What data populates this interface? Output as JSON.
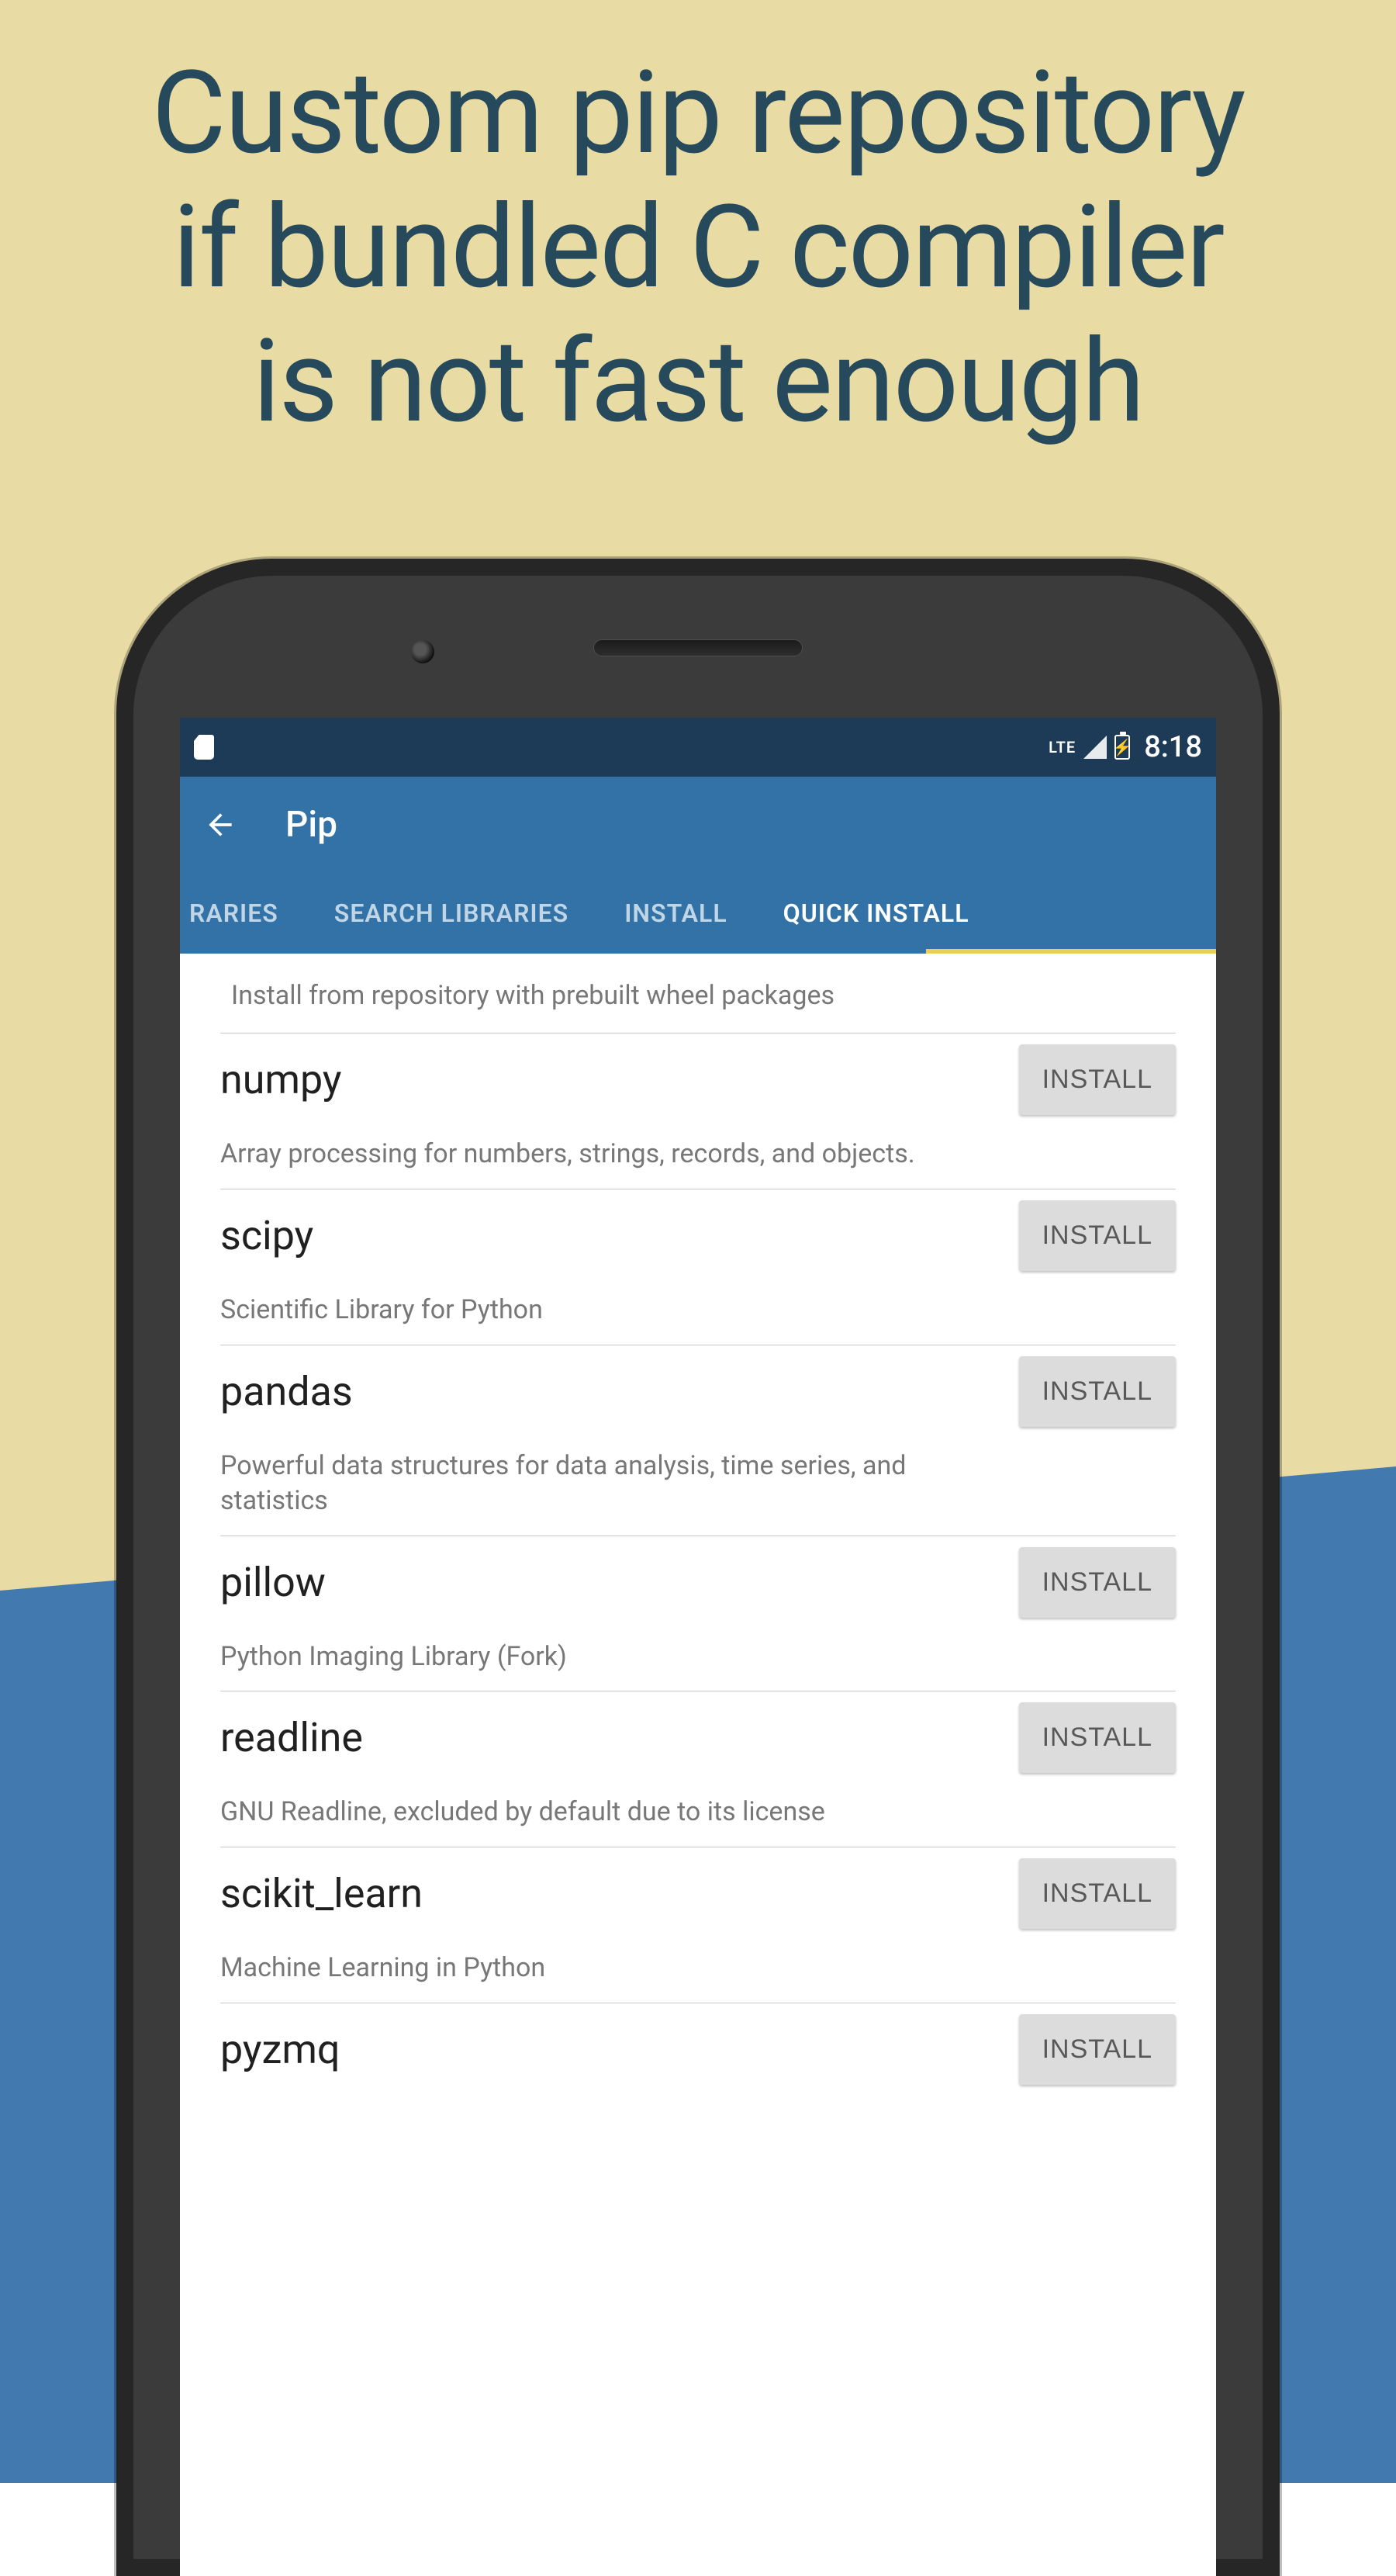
{
  "marketing": {
    "headline_l1": "Custom pip repository",
    "headline_l2": "if bundled C compiler",
    "headline_l3": "is not fast enough"
  },
  "statusbar": {
    "lte": "LTE",
    "time": "8:18"
  },
  "appbar": {
    "title": "Pip"
  },
  "tabs": {
    "items": [
      {
        "label": "RARIES",
        "active": false
      },
      {
        "label": "SEARCH LIBRARIES",
        "active": false
      },
      {
        "label": "INSTALL",
        "active": false
      },
      {
        "label": "QUICK INSTALL",
        "active": true
      }
    ]
  },
  "content": {
    "intro": "Install from repository with prebuilt wheel packages",
    "install_label": "INSTALL",
    "packages": [
      {
        "name": "numpy",
        "desc": "Array processing for numbers, strings, records, and objects."
      },
      {
        "name": "scipy",
        "desc": "Scientific Library for Python"
      },
      {
        "name": "pandas",
        "desc": "Powerful data structures for data analysis, time series, and statistics"
      },
      {
        "name": "pillow",
        "desc": "Python Imaging Library (Fork)"
      },
      {
        "name": "readline",
        "desc": "GNU Readline, excluded by default due to its license"
      },
      {
        "name": "scikit_learn",
        "desc": "Machine Learning in Python"
      },
      {
        "name": "pyzmq",
        "desc": ""
      }
    ]
  }
}
